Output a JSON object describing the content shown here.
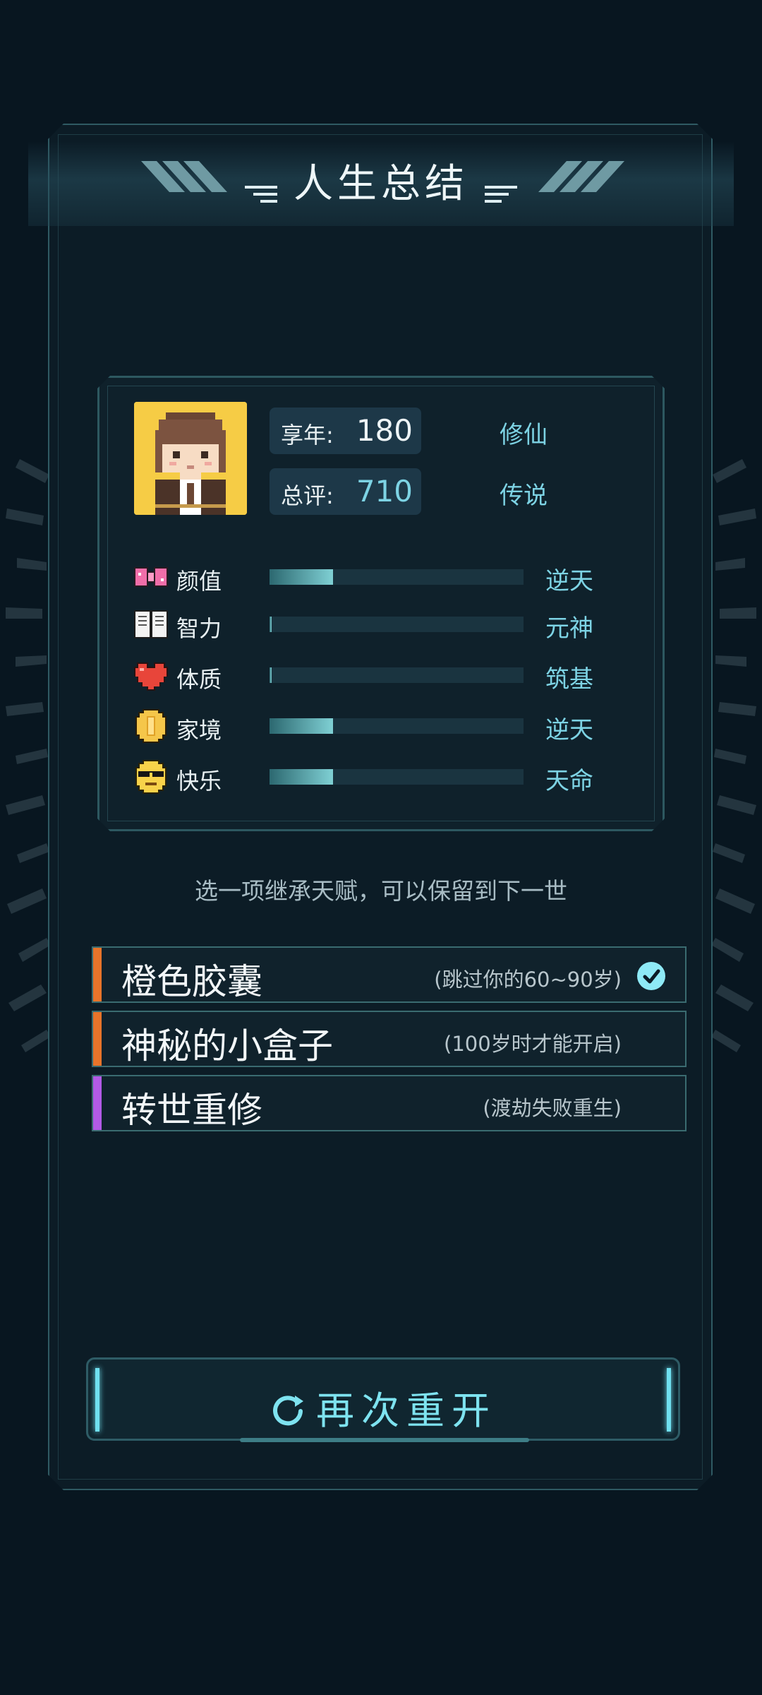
{
  "title": "人生总结",
  "summary": {
    "age_label": "享年:",
    "age_value": "180",
    "age_tag": "修仙",
    "score_label": "总评:",
    "score_value": "710",
    "score_tag": "传说"
  },
  "stats": [
    {
      "name": "颜值",
      "rank": "逆天",
      "level": 0.25,
      "icon": "bow-icon"
    },
    {
      "name": "智力",
      "rank": "元神",
      "level": 0.0,
      "icon": "book-icon"
    },
    {
      "name": "体质",
      "rank": "筑基",
      "level": 0.0,
      "icon": "heart-icon"
    },
    {
      "name": "家境",
      "rank": "逆天",
      "level": 0.25,
      "icon": "coin-icon"
    },
    {
      "name": "快乐",
      "rank": "天命",
      "level": 0.25,
      "icon": "sunglasses-face-icon"
    }
  ],
  "hint": "选一项继承天赋，可以保留到下一世",
  "options": [
    {
      "name": "橙色胶囊",
      "desc": "(跳过你的60~90岁)",
      "color": "#e8742a",
      "selected": true
    },
    {
      "name": "神秘的小盒子",
      "desc": "(100岁时才能开启)",
      "color": "#e8742a",
      "selected": false
    },
    {
      "name": "转世重修",
      "desc": "(渡劫失败重生)",
      "color": "#b25ae6",
      "selected": false
    }
  ],
  "restart_label": "再次重开",
  "colors": {
    "accent": "#7dd3e4",
    "background": "#081620",
    "panel": "#0c1c26"
  }
}
